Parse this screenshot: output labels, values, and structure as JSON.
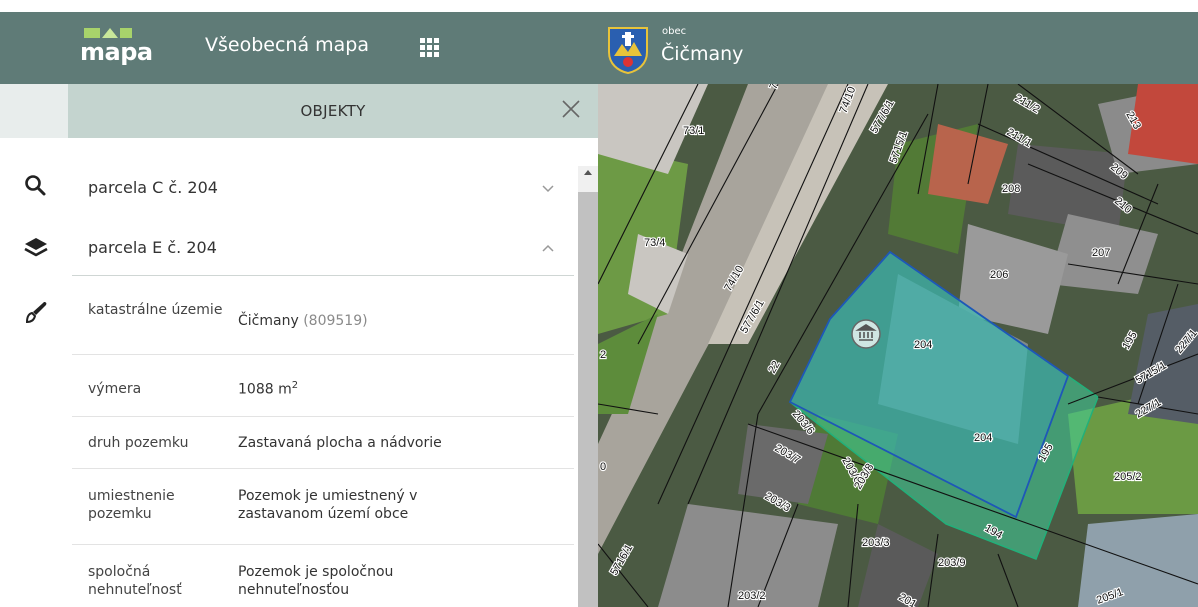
{
  "header": {
    "logo_text": "mapa",
    "app_title": "Všeobecná mapa",
    "municipality_prefix": "obec",
    "municipality_name": "Čičmany",
    "bg": "#5f7b77"
  },
  "panel": {
    "title": "OBJEKTY",
    "head_bg": "#c4d4cf",
    "accordions": [
      {
        "label": "parcela C č. 204",
        "expanded": false
      },
      {
        "label": "parcela E č. 204",
        "expanded": true
      }
    ],
    "attributes": {
      "cadastral": {
        "key": "katastrálne územie",
        "value": "Čičmany",
        "code": "(809519)"
      },
      "area": {
        "key": "výmera",
        "value": "1088 m",
        "unit_sup": "2"
      },
      "land_type": {
        "key": "druh pozemku",
        "value": "Zastavaná plocha a nádvorie"
      },
      "location": {
        "key": "umiestnenie pozemku",
        "value": "Pozemok je umiestnený v zastavanom území obce"
      },
      "shared": {
        "key": "spoločná nehnuteľnosť",
        "value": "Pozemok je spoločnou nehnuteľnosťou"
      }
    }
  },
  "rail": {
    "icons": [
      "search-icon",
      "layers-icon",
      "brush-icon"
    ]
  },
  "map": {
    "highlight_color": "#3fd19a",
    "parcel_labels": [
      "73/6",
      "74/10",
      "211/2",
      "213",
      "73/1",
      "577/6/1",
      "5715/1",
      "211/1",
      "208",
      "209",
      "210",
      "73/4",
      "207",
      "206",
      "74/10",
      "577/6/1",
      "204",
      "195",
      "227/1",
      "22",
      "5715/1",
      "227/1",
      "204",
      "2",
      "203/6",
      "203/7",
      "203/6",
      "203/8",
      "195",
      "205/2",
      "0",
      "203/3",
      "194",
      "203/3",
      "203/9",
      "5716/1",
      "203/2",
      "201",
      "205/1"
    ]
  }
}
